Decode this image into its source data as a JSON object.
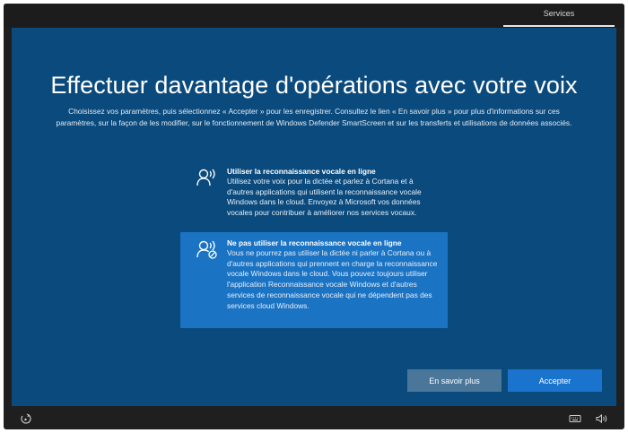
{
  "header": {
    "tab_label": "Services"
  },
  "page": {
    "title": "Effectuer davantage d'opérations avec votre voix",
    "subtitle": "Choisissez vos paramètres, puis sélectionnez « Accepter » pour les enregistrer. Consultez le lien « En savoir plus » pour plus d'informations sur ces paramètres, sur la façon de les modifier, sur le fonctionnement de Windows Defender SmartScreen et sur les transferts et utilisations de données associés."
  },
  "options": [
    {
      "icon": "speech-recognition-icon",
      "title": "Utiliser la reconnaissance vocale en ligne",
      "description": "Utilisez votre voix pour la dictée et parlez à Cortana et à d'autres applications qui utilisent la reconnaissance vocale Windows dans le cloud. Envoyez à Microsoft vos données vocales pour contribuer à améliorer nos services vocaux.",
      "selected": false
    },
    {
      "icon": "speech-recognition-off-icon",
      "title": "Ne pas utiliser la reconnaissance vocale en ligne",
      "description": "Vous ne pourrez pas utiliser la dictée ni parler à Cortana ou à d'autres applications qui prennent en charge la reconnaissance vocale Windows dans le cloud. Vous pouvez toujours utiliser l'application Reconnaissance vocale Windows et d'autres services de reconnaissance vocale qui ne dépendent pas des services cloud Windows.",
      "selected": true
    }
  ],
  "buttons": {
    "learn_more": "En savoir plus",
    "accept": "Accepter"
  },
  "footer": {
    "left_icon": "accessibility-icon",
    "right_icons": [
      "keyboard-icon",
      "volume-icon"
    ]
  },
  "colors": {
    "panel": "#0b4a7d",
    "selected_option": "#1b73c4",
    "accept_button": "#1a73cd",
    "learn_more_button": "#4a7699",
    "chrome": "#1f1f1f"
  }
}
